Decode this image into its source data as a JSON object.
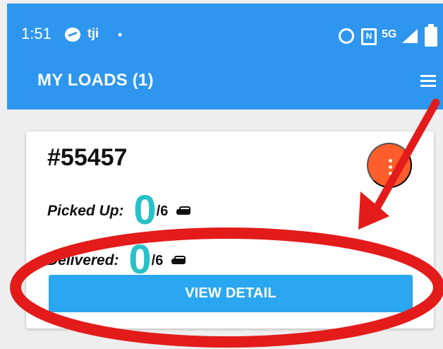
{
  "status_bar": {
    "time": "1:51",
    "teams_icon_label": "tji",
    "dot": "•",
    "nfc_label": "N",
    "network": "5G"
  },
  "header": {
    "title": "MY LOADS (1)"
  },
  "card": {
    "order_number": "#55457",
    "picked_up_label": "Picked Up:",
    "picked_up_value": "0",
    "picked_up_total": "/6",
    "delivered_label": "Delivered:",
    "delivered_value": "0",
    "delivered_total": "/6",
    "view_detail_label": "VIEW DETAIL"
  },
  "icons": {
    "messenger": "messenger-icon",
    "teams": "teams-icon",
    "alarm": "alarm-icon",
    "nfc": "nfc-icon",
    "signal": "signal-icon",
    "battery": "battery-icon",
    "menu": "hamburger-menu-icon",
    "more": "more-vertical-icon",
    "car": "car-icon"
  },
  "colors": {
    "appbar": "#2e96ef",
    "accent": "#27c1c8",
    "button": "#2aa7f0",
    "fab": "#ff5d2b",
    "annotation": "#e31b1b"
  }
}
